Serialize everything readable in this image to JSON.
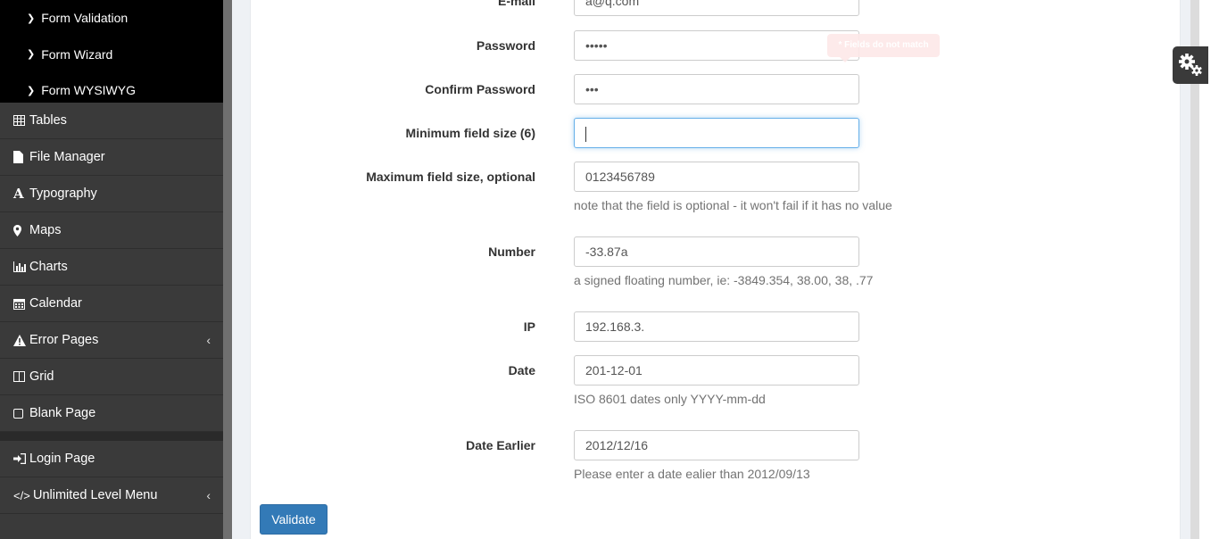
{
  "sidebar": {
    "submenu": [
      {
        "label": "Form Validation"
      },
      {
        "label": "Form Wizard"
      },
      {
        "label": "Form WYSIWYG"
      }
    ],
    "items": [
      {
        "label": "Tables",
        "icon": "table-icon"
      },
      {
        "label": "File Manager",
        "icon": "file-icon"
      },
      {
        "label": "Typography",
        "icon": "font-icon"
      },
      {
        "label": "Maps",
        "icon": "map-marker-icon"
      },
      {
        "label": "Charts",
        "icon": "bar-chart-icon"
      },
      {
        "label": "Calendar",
        "icon": "calendar-icon"
      },
      {
        "label": "Error Pages",
        "icon": "warning-icon",
        "has_children": true
      },
      {
        "label": "Grid",
        "icon": "columns-icon"
      },
      {
        "label": "Blank Page",
        "icon": "square-icon"
      }
    ],
    "bottom_items": [
      {
        "label": "Login Page",
        "icon": "sign-in-icon"
      },
      {
        "label": "Unlimited Level Menu",
        "icon": "code-icon",
        "has_children": true
      }
    ]
  },
  "form": {
    "email": {
      "label": "E-mail",
      "value": "a@q.com"
    },
    "password": {
      "label": "Password",
      "value": "•••••"
    },
    "confirm_password": {
      "label": "Confirm Password",
      "value": "•••"
    },
    "tooltip": "* Fields do not match",
    "min_field": {
      "label": "Minimum field size (6)",
      "value": ""
    },
    "max_field": {
      "label": "Maximum field size, optional",
      "value": "0123456789",
      "help": "note that the field is optional - it won't fail if it has no value"
    },
    "number": {
      "label": "Number",
      "value": "-33.87a",
      "help": "a signed floating number, ie: -3849.354, 38.00, 38, .77"
    },
    "ip": {
      "label": "IP",
      "value": "192.168.3."
    },
    "date": {
      "label": "Date",
      "value": "201-12-01",
      "help": "ISO 8601 dates only YYYY-mm-dd"
    },
    "date_earlier": {
      "label": "Date Earlier",
      "value": "2012/12/16",
      "help": "Please enter a date ealier than 2012/09/13"
    },
    "submit_label": "Validate"
  },
  "colors": {
    "primary": "#337ab7",
    "sidebar": "#3a3a3a",
    "submenu": "#000000"
  }
}
